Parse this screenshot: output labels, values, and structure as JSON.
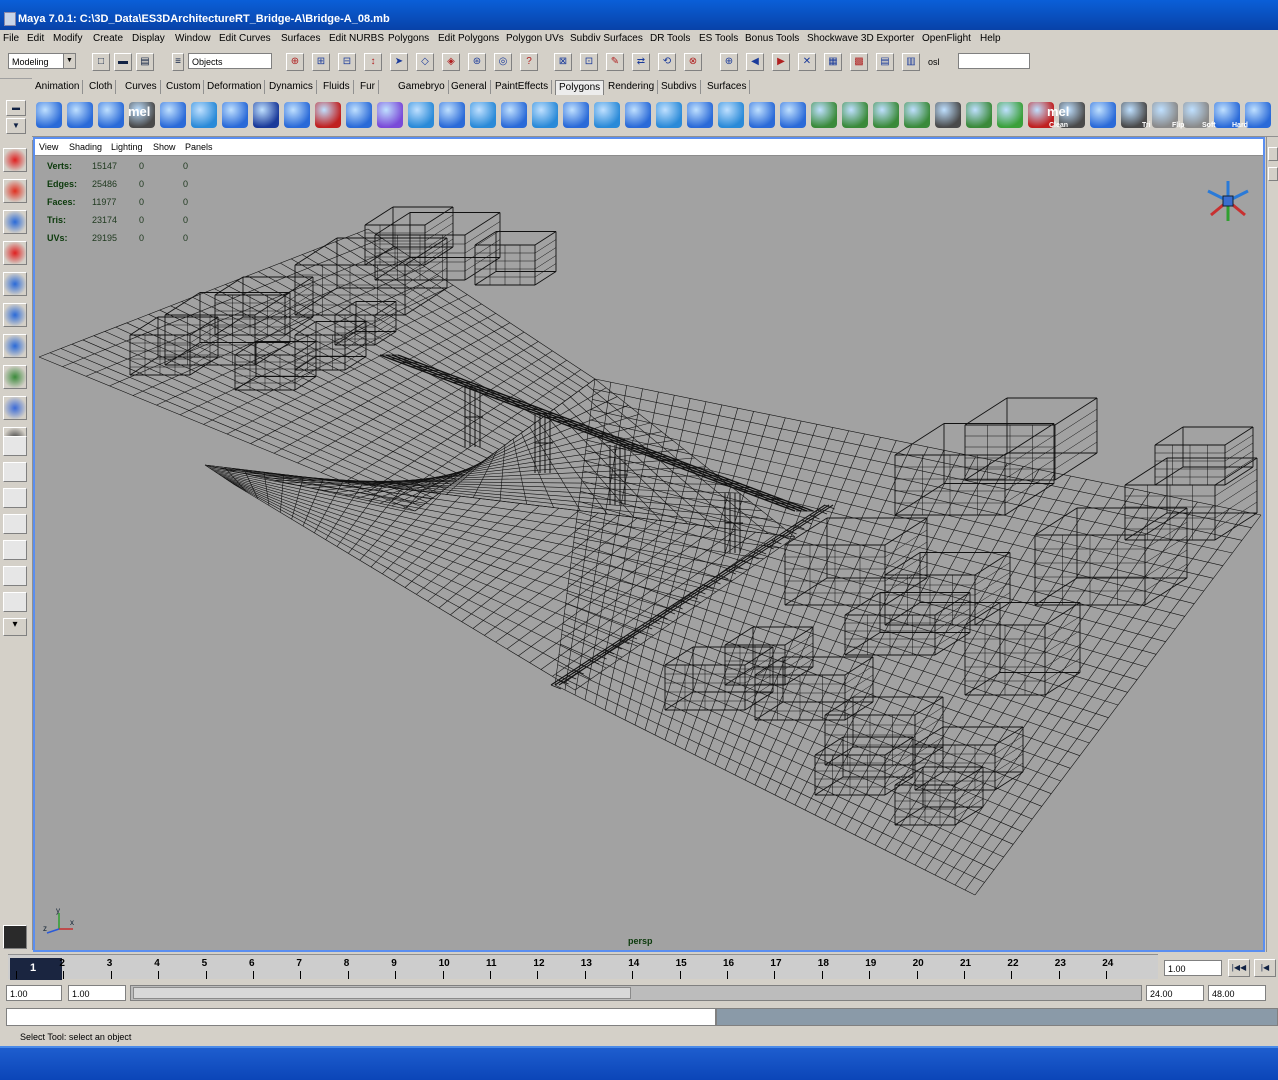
{
  "window": {
    "title": "Maya 7.0.1: C:\\3D_Data\\ES3DArchitectureRT_Bridge-A\\Bridge-A_08.mb"
  },
  "menubar": {
    "items": [
      "File",
      "Edit",
      "Modify",
      "Create",
      "Display",
      "Window",
      "Edit Curves",
      "Surfaces",
      "Edit NURBS",
      "Polygons",
      "Edit Polygons",
      "Polygon UVs",
      "Subdiv Surfaces",
      "DR Tools",
      "ES Tools",
      "Bonus Tools",
      "Shockwave 3D Exporter",
      "OpenFlight",
      "Help"
    ]
  },
  "statusline": {
    "menuset": "Modeling",
    "selection_mode": "Objects",
    "quick_select_label": "osl"
  },
  "shelf_tabs": {
    "items": [
      "Animation",
      "Cloth",
      "Curves",
      "Custom",
      "Deformation",
      "Dynamics",
      "Fluids",
      "Fur",
      "Gamebryo",
      "General",
      "PaintEffects",
      "Polygons",
      "Rendering",
      "Subdivs",
      "Surfaces"
    ],
    "active": "Polygons"
  },
  "shelf_icons": {
    "mel1": "mel",
    "mel2": "mel",
    "clean": "Clean",
    "tri": "Tri",
    "flip": "Flip",
    "soft": "Soft",
    "hard": "Hard"
  },
  "viewport": {
    "panel_menu": [
      "View",
      "Shading",
      "Lighting",
      "Show",
      "Panels"
    ],
    "hud": [
      {
        "label": "Verts:",
        "v1": "15147",
        "v2": "0",
        "v3": "0"
      },
      {
        "label": "Edges:",
        "v1": "25486",
        "v2": "0",
        "v3": "0"
      },
      {
        "label": "Faces:",
        "v1": "11977",
        "v2": "0",
        "v3": "0"
      },
      {
        "label": "Tris:",
        "v1": "23174",
        "v2": "0",
        "v3": "0"
      },
      {
        "label": "UVs:",
        "v1": "29195",
        "v2": "0",
        "v3": "0"
      }
    ],
    "camera": "persp",
    "axis": {
      "x": "x",
      "y": "y",
      "z": "z"
    }
  },
  "timeslider": {
    "current_frame": "1",
    "ticks": [
      "2",
      "3",
      "4",
      "5",
      "6",
      "7",
      "8",
      "9",
      "10",
      "11",
      "12",
      "13",
      "14",
      "15",
      "16",
      "17",
      "18",
      "19",
      "20",
      "21",
      "22",
      "23",
      "24"
    ],
    "current_time_field": "1.00"
  },
  "rangeslider": {
    "start_time": "1.00",
    "playback_start": "1.00",
    "playback_end": "24.00",
    "end_time": "48.00"
  },
  "helpline": {
    "text": "Select Tool: select an object"
  },
  "colors": {
    "title_bar": "#0a5fd8",
    "viewport_bg": "#a2a2a2",
    "viewport_border": "#5a8ef0",
    "wireframe": "#111111",
    "hud_text": "#0c3a0c",
    "taskbar": "#1f5fd0"
  }
}
